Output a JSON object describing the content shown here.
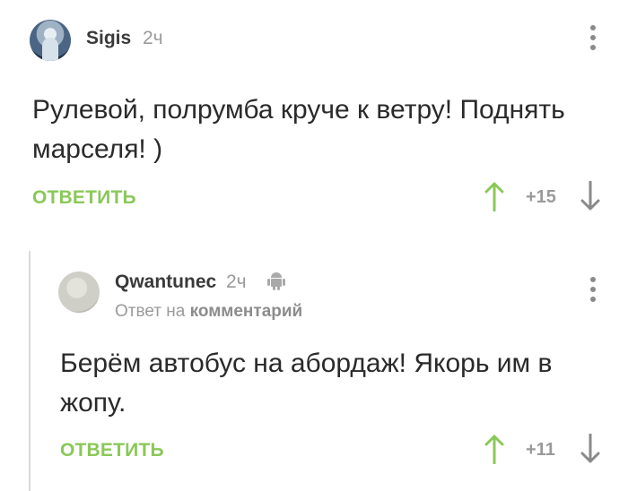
{
  "colors": {
    "accent_green": "#8ac858",
    "muted_gray": "#9a9a9a",
    "text": "#2a2a2a"
  },
  "comments": [
    {
      "author": "Sigis",
      "time": "2ч",
      "text": "Рулевой, полрумба круче к ветру! Поднять марселя! )",
      "reply_label": "ОТВЕТИТЬ",
      "rating": "+15",
      "icons": [
        "avatar",
        "more-vertical-icon",
        "arrow-up-icon",
        "arrow-down-icon"
      ]
    },
    {
      "author": "Qwantunec",
      "time": "2ч",
      "platform_icon": "android-icon",
      "reply_to_prefix": "Ответ на",
      "reply_to_target": "комментарий",
      "text": "Берём автобус на абордаж! Якорь им в жопу.",
      "reply_label": "ОТВЕТИТЬ",
      "rating": "+11",
      "icons": [
        "avatar",
        "android-icon",
        "more-vertical-icon",
        "arrow-up-icon",
        "arrow-down-icon"
      ]
    }
  ]
}
